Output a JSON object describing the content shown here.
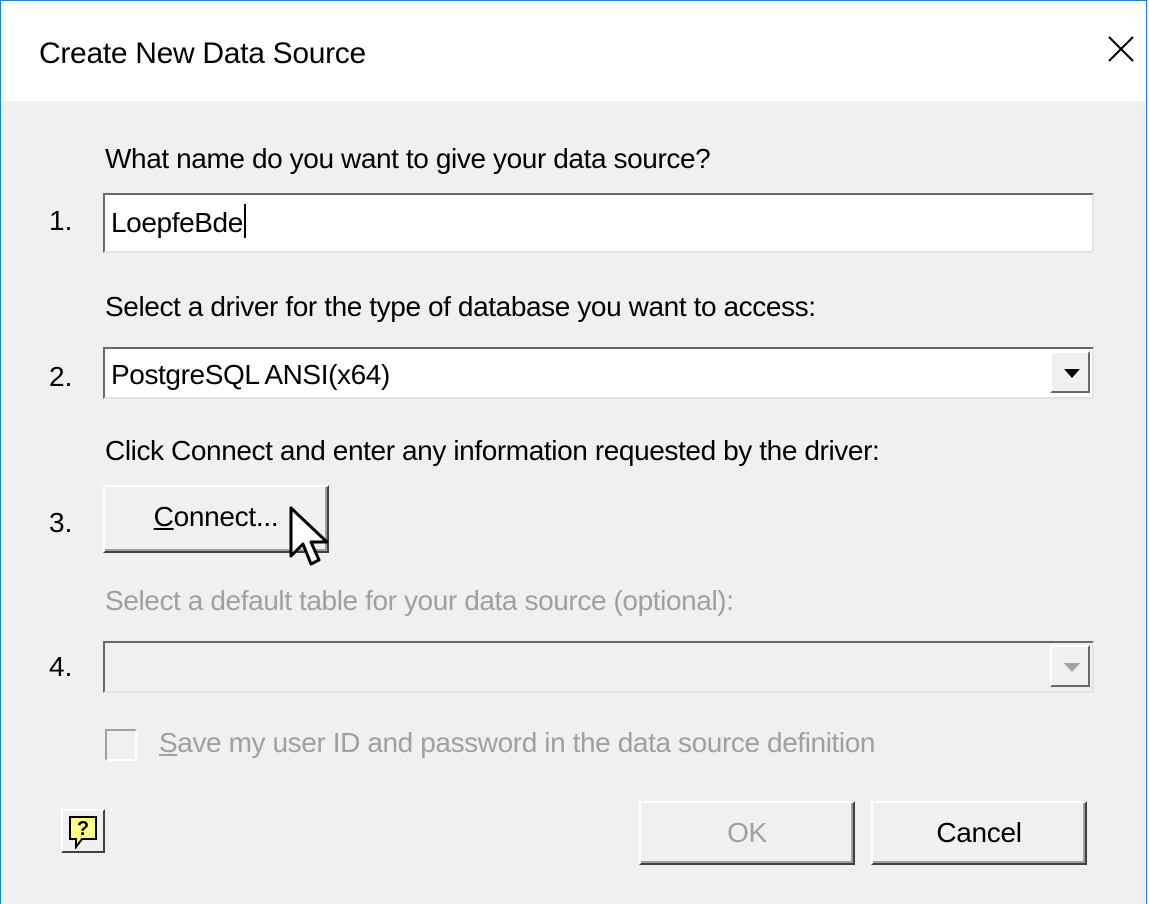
{
  "window": {
    "title": "Create New Data Source",
    "close_symbol": "×"
  },
  "steps": {
    "step1": {
      "number": "1.",
      "prompt": "What name do you want to give your data source?",
      "value": "LoepfeBde"
    },
    "step2": {
      "number": "2.",
      "prompt": "Select a driver for the type of database you want to access:",
      "selected": "PostgreSQL ANSI(x64)"
    },
    "step3": {
      "number": "3.",
      "prompt": "Click Connect and enter any information requested by the driver:",
      "button_underline": "C",
      "button_rest": "onnect..."
    },
    "step4": {
      "number": "4.",
      "prompt": "Select a default table for your data source (optional):",
      "selected": "",
      "enabled": false
    }
  },
  "save_credentials": {
    "underline": "S",
    "rest": "ave my user ID and password in the data source definition",
    "checked": false,
    "enabled": false
  },
  "buttons": {
    "ok": "OK",
    "cancel": "Cancel",
    "help_icon": "help-question-icon"
  },
  "colors": {
    "window_border": "#1883d7",
    "dialog_bg": "#f0f0f0",
    "disabled_text": "#a0a0a0"
  }
}
